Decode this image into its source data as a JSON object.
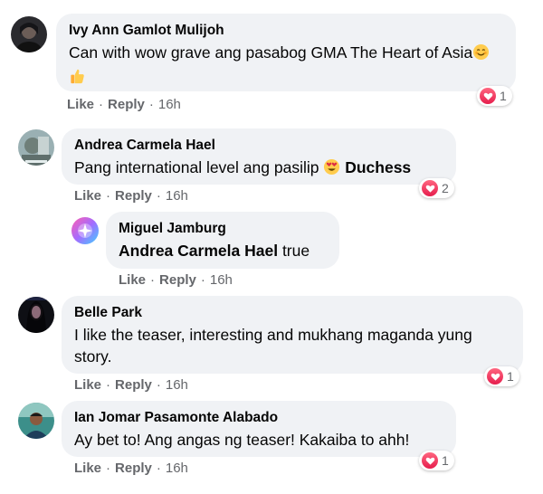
{
  "comments": [
    {
      "author": "Ivy Ann Gamlot Mulijoh",
      "text": "Can with wow grave ang pasabog GMA The Heart of Asia",
      "emoji": [
        "smiling-face-icon",
        "thumbs-up-icon"
      ],
      "like": "Like",
      "reply": "Reply",
      "time": "16h",
      "reaction_count": "1"
    },
    {
      "author": "Andrea Carmela Hael",
      "text": "Pang international level ang pasilip",
      "emoji": [
        "heart-eyes-icon"
      ],
      "trailing_bold": "Duchess",
      "like": "Like",
      "reply": "Reply",
      "time": "16h",
      "reaction_count": "2"
    },
    {
      "author": "Miguel Jamburg",
      "mention": "Andrea Carmela Hael",
      "text": "true",
      "like": "Like",
      "reply": "Reply",
      "time": "16h"
    },
    {
      "author": "Belle Park",
      "text": "I like the teaser, interesting and mukhang maganda yung story.",
      "like": "Like",
      "reply": "Reply",
      "time": "16h",
      "reaction_count": "1"
    },
    {
      "author": "Ian Jomar Pasamonte Alabado",
      "text": "Ay bet to! Ang angas ng teaser! Kakaiba to ahh!",
      "like": "Like",
      "reply": "Reply",
      "time": "16h",
      "reaction_count": "1"
    }
  ],
  "separator": "·",
  "colors": {
    "bubble": "#f0f2f5",
    "meta_text": "#65676b",
    "love_reaction": "#e61e4d"
  }
}
